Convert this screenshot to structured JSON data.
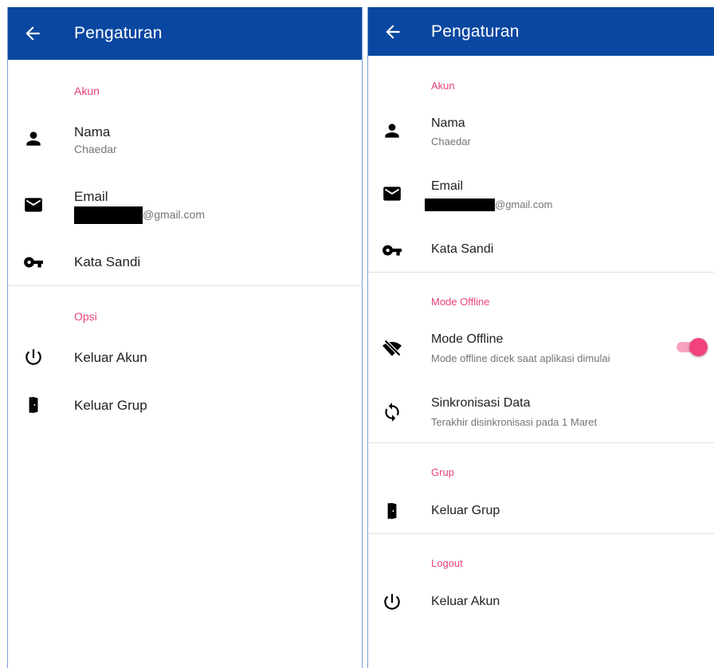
{
  "colors": {
    "appbar": "#0a47a1",
    "section_header": "#e8437b",
    "toggle_thumb": "#f0437c",
    "toggle_track": "#f7a3bd"
  },
  "left": {
    "title": "Pengaturan",
    "back_icon": "arrow-left-icon",
    "sections": {
      "account": "Akun",
      "options": "Opsi"
    },
    "items": {
      "name": {
        "icon": "person-icon",
        "label": "Nama",
        "value": "Chaedar"
      },
      "email": {
        "icon": "mail-icon",
        "label": "Email",
        "value": "@gmail.com"
      },
      "password": {
        "icon": "key-icon",
        "label": "Kata Sandi"
      },
      "logout": {
        "icon": "power-icon",
        "label": "Keluar Akun"
      },
      "leave_group": {
        "icon": "door-icon",
        "label": "Keluar Grup"
      }
    }
  },
  "right": {
    "title": "Pengaturan",
    "back_icon": "arrow-left-icon",
    "sections": {
      "account": "Akun",
      "offline": "Mode Offline",
      "group": "Grup",
      "logout": "Logout"
    },
    "items": {
      "name": {
        "icon": "person-icon",
        "label": "Nama",
        "value": "Chaedar"
      },
      "email": {
        "icon": "mail-icon",
        "label": "Email",
        "value": "@gmail.com"
      },
      "password": {
        "icon": "key-icon",
        "label": "Kata Sandi"
      },
      "offline_mode": {
        "icon": "wifi-off-icon",
        "label": "Mode Offline",
        "description": "Mode offline dicek saat aplikasi dimulai",
        "enabled": true
      },
      "sync": {
        "icon": "sync-icon",
        "label": "Sinkronisasi Data",
        "description": "Terakhir disinkronisasi pada 1 Maret"
      },
      "leave_group": {
        "icon": "door-icon",
        "label": "Keluar Grup"
      },
      "logout": {
        "icon": "power-icon",
        "label": "Keluar Akun"
      }
    }
  }
}
